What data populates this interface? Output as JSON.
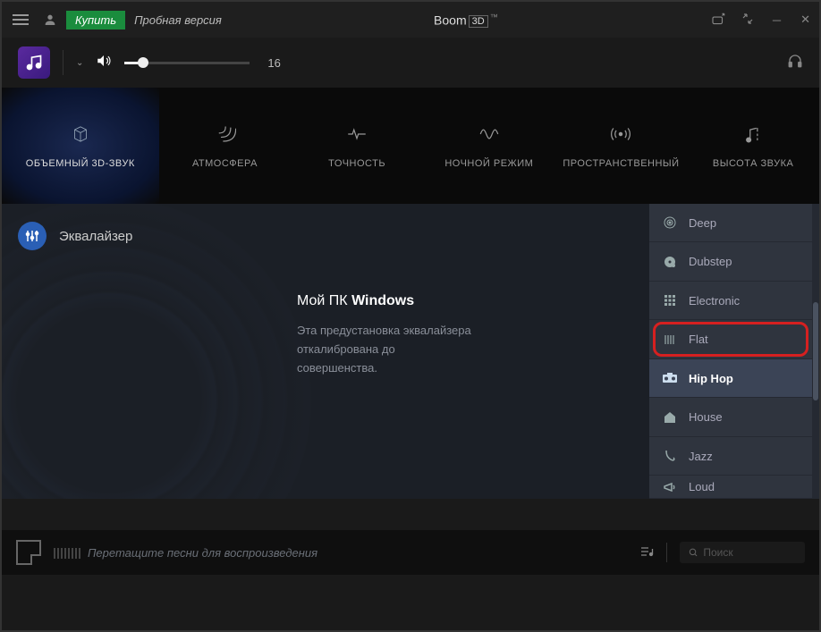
{
  "titlebar": {
    "buy_label": "Купить",
    "trial_label": "Пробная версия",
    "title_main": "Boom",
    "title_box": "3D",
    "tm": "™"
  },
  "volume": {
    "value": "16"
  },
  "tabs": [
    {
      "label": "ОБЪЕМНЫЙ 3D-ЗВУК"
    },
    {
      "label": "АТМОСФЕРА"
    },
    {
      "label": "ТОЧНОСТЬ"
    },
    {
      "label": "НОЧНОЙ РЕЖИМ"
    },
    {
      "label": "ПРОСТРАНСТВЕННЫЙ"
    },
    {
      "label": "ВЫСОТА ЗВУКА"
    }
  ],
  "equalizer": {
    "title": "Эквалайзер",
    "heading_prefix": "Мой ПК",
    "heading_bold": "Windows",
    "description": "Эта предустановка эквалайзера откалибрована до совершенства."
  },
  "presets": [
    {
      "label": "Deep"
    },
    {
      "label": "Dubstep"
    },
    {
      "label": "Electronic"
    },
    {
      "label": "Flat"
    },
    {
      "label": "Hip Hop"
    },
    {
      "label": "House"
    },
    {
      "label": "Jazz"
    },
    {
      "label": "Loud"
    }
  ],
  "player": {
    "drag_text": "Перетащите песни для воспроизведения",
    "search_placeholder": "Поиск"
  }
}
